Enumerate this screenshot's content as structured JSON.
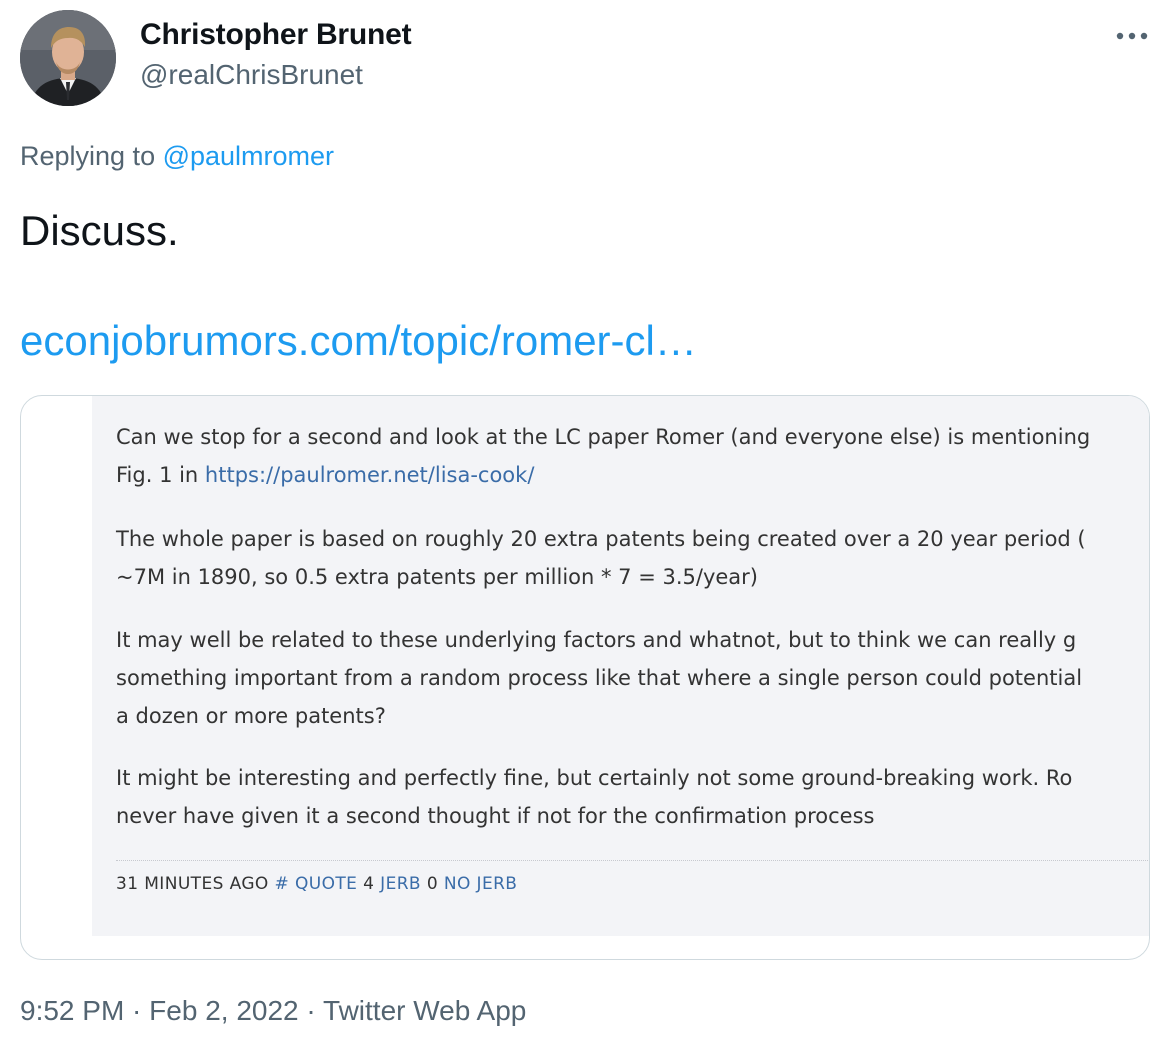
{
  "author": {
    "display_name": "Christopher Brunet",
    "handle": "@realChrisBrunet"
  },
  "more_icon": "more-horizontal-icon",
  "reply": {
    "prefix": "Replying to ",
    "mention": "@paulmromer"
  },
  "tweet": {
    "text": "Discuss.",
    "link": "econjobrumors.com/topic/romer-cl…"
  },
  "embedded_post": {
    "paragraphs": [
      {
        "lines": [
          "Can we stop for a second and look at the LC paper Romer (and everyone else) is mentioning",
          "Fig. 1 in "
        ],
        "link": "https://paulromer.net/lisa-cook/"
      },
      {
        "lines": [
          "The whole paper is based on roughly 20 extra patents being created over a 20 year period (",
          "~7M in 1890, so 0.5 extra patents per million * 7 = 3.5/year)"
        ]
      },
      {
        "lines": [
          "It may well be related to these underlying factors and whatnot, but to think we can really g",
          "something important from a random process like that where a single person could potential",
          "a dozen or more patents?"
        ]
      },
      {
        "lines": [
          "It might be interesting and perfectly fine, but certainly not some ground-breaking work. Ro",
          "never have given it a second thought if not for the confirmation process"
        ]
      }
    ],
    "footer": {
      "time": "31 MINUTES AGO",
      "hash": "#",
      "quote": "QUOTE",
      "jerb_count": "4",
      "jerb": "JERB",
      "no_jerb_count": "0",
      "no_jerb": "NO JERB"
    }
  },
  "meta": {
    "time": "9:52 PM",
    "sep1": " · ",
    "date": "Feb 2, 2022",
    "sep2": " · ",
    "source": "Twitter Web App"
  },
  "colors": {
    "link": "#1d9bf0",
    "secondary_text": "#536471",
    "primary_text": "#0f1419",
    "card_border": "#cfd9de",
    "forum_bg": "#f3f4f7",
    "forum_link": "#3a6ca8"
  }
}
